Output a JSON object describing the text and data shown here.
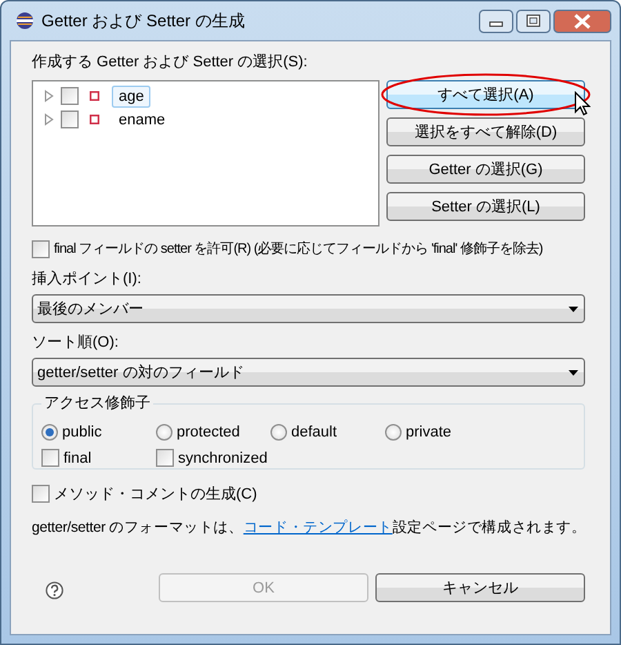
{
  "window": {
    "title": "Getter および Setter の生成"
  },
  "fields_label": "作成する Getter および Setter の選択(S):",
  "fields": [
    {
      "name": "age",
      "checked": false,
      "selected": true
    },
    {
      "name": "ename",
      "checked": false,
      "selected": false
    }
  ],
  "side_buttons": [
    {
      "label": "すべて選択(A)",
      "highlighted": true
    },
    {
      "label": "選択をすべて解除(D)",
      "highlighted": false
    },
    {
      "label": "Getter の選択(G)",
      "highlighted": false
    },
    {
      "label": "Setter の選択(L)",
      "highlighted": false
    }
  ],
  "allow_final_setter": {
    "label": "final フィールドの setter を許可(R) (必要に応じてフィールドから 'final' 修飾子を除去)",
    "checked": false
  },
  "insertion_point": {
    "label": "挿入ポイント(I):",
    "value": "最後のメンバー"
  },
  "sort_order": {
    "label": "ソート順(O):",
    "value": "getter/setter の対のフィールド"
  },
  "access_modifier": {
    "title": "アクセス修飾子",
    "radios": [
      {
        "label": "public",
        "selected": true
      },
      {
        "label": "protected",
        "selected": false
      },
      {
        "label": "default",
        "selected": false
      },
      {
        "label": "private",
        "selected": false
      }
    ],
    "checkboxes": [
      {
        "label": "final",
        "checked": false
      },
      {
        "label": "synchronized",
        "checked": false
      }
    ]
  },
  "generate_comments": {
    "label": "メソッド・コメントの生成(C)",
    "checked": false
  },
  "format_note": {
    "before": "getter/setter のフォーマットは、",
    "link": "コード・テンプレート",
    "after": "設定ページで構成されます。"
  },
  "buttons": [
    {
      "label": "OK",
      "disabled": true
    },
    {
      "label": "キャンセル",
      "disabled": false
    }
  ]
}
